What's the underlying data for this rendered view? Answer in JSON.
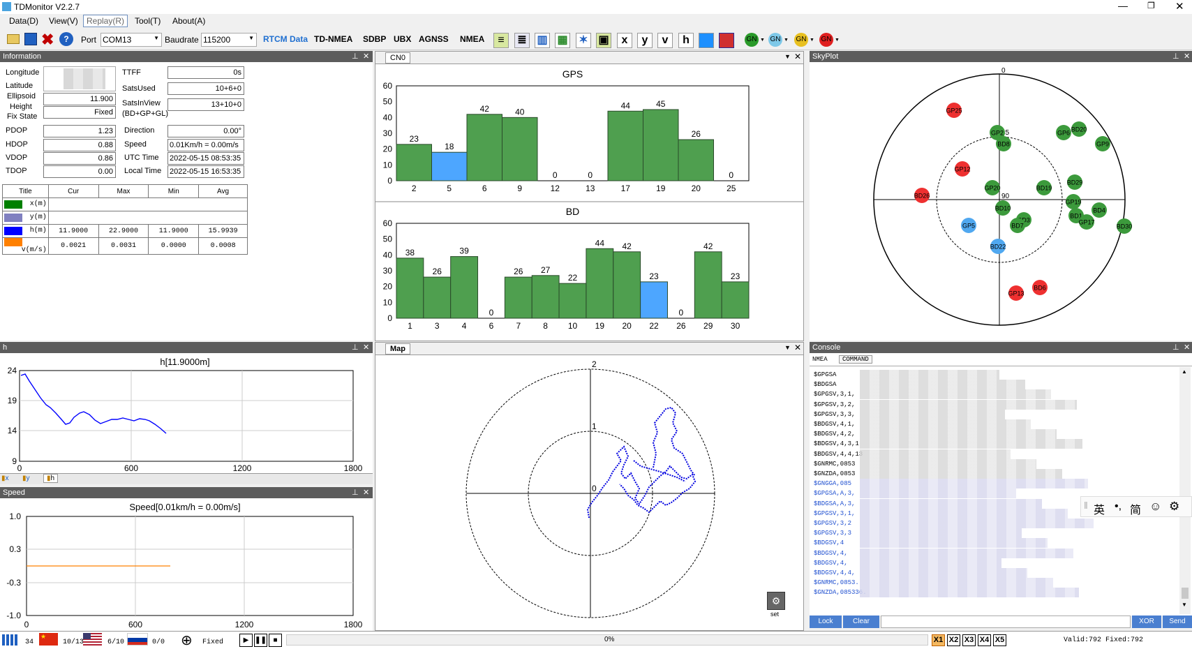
{
  "app": {
    "title": "TDMonitor V2.2.7"
  },
  "menu": [
    "Data(D)",
    "View(V)",
    "Replay(R)",
    "Tool(T)",
    "About(A)"
  ],
  "toolbar": {
    "port_label": "Port",
    "port_value": "COM13",
    "baud_label": "Baudrate",
    "baud_value": "115200",
    "protocols": [
      "RTCM Data",
      "TD-NMEA",
      "SDBP",
      "UBX",
      "AGNSS",
      "NMEA"
    ],
    "letter_buttons": [
      "x",
      "y",
      "v",
      "h"
    ],
    "gnss_badges": [
      "GN",
      "GN",
      "GN",
      "GN"
    ]
  },
  "info": {
    "title": "Information",
    "left_labels": [
      "Longitude",
      "Latitude",
      "Ellipsoid",
      "Height",
      "Fix State",
      "PDOP",
      "HDOP",
      "VDOP",
      "TDOP"
    ],
    "ellipsoid_value": "11.900",
    "fix_value": "Fixed",
    "pdop": "1.23",
    "hdop": "0.88",
    "vdop": "0.86",
    "tdop": "0.00",
    "right_labels": [
      "TTFF",
      "SatsUsed",
      "SatsInView",
      "(BD+GP+GL)",
      "Direction",
      "Speed",
      "UTC Time",
      "Local Time"
    ],
    "ttff": "0s",
    "sats_used": "10+6+0",
    "sats_in_view": "13+10+0",
    "direction": "0.00°",
    "speed": "0.01Km/h = 0.00m/s",
    "utc": "2022-05-15 08:53:35",
    "local": "2022-05-15 16:53:35",
    "table_header": [
      "Title",
      "Cur",
      "Max",
      "Min",
      "Avg"
    ],
    "rows": [
      {
        "label": "x(m)",
        "color": "#008000",
        "vals": [
          "",
          "",
          "",
          ""
        ]
      },
      {
        "label": "y(m)",
        "color": "#8080c0",
        "vals": [
          "",
          "",
          "",
          ""
        ]
      },
      {
        "label": "h(m)",
        "color": "#0000ff",
        "vals": [
          "11.9000",
          "22.9000",
          "11.9000",
          "15.9939"
        ]
      },
      {
        "label": "v(m/s)",
        "color": "#ff8000",
        "vals": [
          "0.0021",
          "0.0031",
          "0.0000",
          "0.0008"
        ]
      }
    ]
  },
  "cn0": {
    "tab": "CN0",
    "gps": {
      "title": "GPS",
      "categories": [
        "2",
        "5",
        "6",
        "9",
        "12",
        "13",
        "17",
        "19",
        "20",
        "25"
      ],
      "values": [
        23,
        18,
        42,
        40,
        0,
        0,
        44,
        45,
        26,
        0
      ],
      "highlight": [
        1
      ],
      "y_ticks": [
        "0",
        "10",
        "20",
        "30",
        "40",
        "50",
        "60"
      ]
    },
    "bd": {
      "title": "BD",
      "categories": [
        "1",
        "3",
        "4",
        "6",
        "7",
        "8",
        "10",
        "19",
        "20",
        "22",
        "26",
        "29",
        "30"
      ],
      "values": [
        38,
        26,
        39,
        0,
        26,
        27,
        22,
        44,
        42,
        23,
        0,
        42,
        23
      ],
      "highlight": [
        9
      ],
      "y_ticks": [
        "0",
        "10",
        "20",
        "30",
        "40",
        "50",
        "60"
      ]
    }
  },
  "skyplot": {
    "title": "SkyPlot",
    "ring_labels": [
      "0",
      "45",
      "90"
    ],
    "sats": [
      {
        "id": "GP25",
        "c": "r"
      },
      {
        "id": "GP2",
        "c": "g"
      },
      {
        "id": "BD8",
        "c": "g"
      },
      {
        "id": "GP6",
        "c": "g"
      },
      {
        "id": "BD20",
        "c": "g"
      },
      {
        "id": "GP9",
        "c": "g"
      },
      {
        "id": "GP12",
        "c": "r"
      },
      {
        "id": "BD29",
        "c": "g"
      },
      {
        "id": "BD26",
        "c": "r"
      },
      {
        "id": "GP20",
        "c": "g"
      },
      {
        "id": "BD19",
        "c": "g"
      },
      {
        "id": "GP19",
        "c": "g"
      },
      {
        "id": "BD10",
        "c": "g"
      },
      {
        "id": "BD4",
        "c": "g"
      },
      {
        "id": "BD3",
        "c": "g"
      },
      {
        "id": "BD1",
        "c": "g"
      },
      {
        "id": "GP5",
        "c": "b"
      },
      {
        "id": "BD7",
        "c": "g"
      },
      {
        "id": "GP17",
        "c": "g"
      },
      {
        "id": "BD30",
        "c": "g"
      },
      {
        "id": "BD22",
        "c": "b"
      },
      {
        "id": "GP13",
        "c": "r"
      },
      {
        "id": "BD6",
        "c": "r"
      }
    ]
  },
  "h_chart": {
    "panel": "h",
    "title": "h[11.9000m]",
    "y_ticks": [
      "24",
      "19",
      "14",
      "9"
    ],
    "x_ticks": [
      "0",
      "600",
      "1200",
      "1800"
    ],
    "tabs": [
      "x",
      "y",
      "h"
    ]
  },
  "speed_chart": {
    "panel": "Speed",
    "title": "Speed[0.01km/h = 0.00m/s]",
    "y_ticks": [
      "1.0",
      "0.3",
      "-0.3",
      "-1.0"
    ],
    "x_ticks": [
      "0",
      "600",
      "1200",
      "1800"
    ]
  },
  "map": {
    "tab": "Map",
    "ring_labels": [
      "2",
      "1",
      "0"
    ],
    "set_label": "set"
  },
  "console": {
    "title": "Console",
    "tabs": [
      "NMEA",
      "COMMAND"
    ],
    "lines": [
      {
        "t": "$GPGSA",
        "b": 0
      },
      {
        "t": "$BDGSA",
        "b": 0
      },
      {
        "t": "$GPGSV,3,1,",
        "b": 0
      },
      {
        "t": "$GPGSV,3,2,",
        "b": 0
      },
      {
        "t": "$GPGSV,3,3,",
        "b": 0
      },
      {
        "t": "$BDGSV,4,1,",
        "b": 0
      },
      {
        "t": "$BDGSV,4,2,",
        "b": 0
      },
      {
        "t": "$BDGSV,4,3,1",
        "b": 0
      },
      {
        "t": "$BDGSV,4,4,13",
        "b": 0
      },
      {
        "t": "$GNRMC,0853",
        "b": 0
      },
      {
        "t": "$GNZDA,0853",
        "b": 0
      },
      {
        "t": "$GNGGA,085",
        "b": 1
      },
      {
        "t": "$GPGSA,A,3,",
        "b": 1
      },
      {
        "t": "$BDGSA,A,3,",
        "b": 1
      },
      {
        "t": "$GPGSV,3,1,",
        "b": 1
      },
      {
        "t": "$GPGSV,3,2",
        "b": 1
      },
      {
        "t": "$GPGSV,3,3",
        "b": 1
      },
      {
        "t": "$BDGSV,4",
        "b": 1
      },
      {
        "t": "$BDGSV,4,",
        "b": 1
      },
      {
        "t": "$BDGSV,4,",
        "b": 1
      },
      {
        "t": "$BDGSV,4,4,",
        "b": 1
      },
      {
        "t": "$GNRMC,0853.",
        "b": 1
      },
      {
        "t": "$GNZDA,085336.",
        "b": 1
      }
    ],
    "buttons": [
      "Lock",
      "Clear",
      "XOR",
      "Send"
    ]
  },
  "ime": {
    "items": [
      "英",
      "•,",
      "简",
      "☺",
      "⚙"
    ]
  },
  "status": {
    "count": "34",
    "cn": "10/13",
    "us": "6/10",
    "ru": "0/0",
    "fix": "Fixed",
    "progress": "0%",
    "speed_buttons": [
      "X1",
      "X2",
      "X3",
      "X4",
      "X5"
    ],
    "valid": "Valid:792 Fixed:792"
  }
}
